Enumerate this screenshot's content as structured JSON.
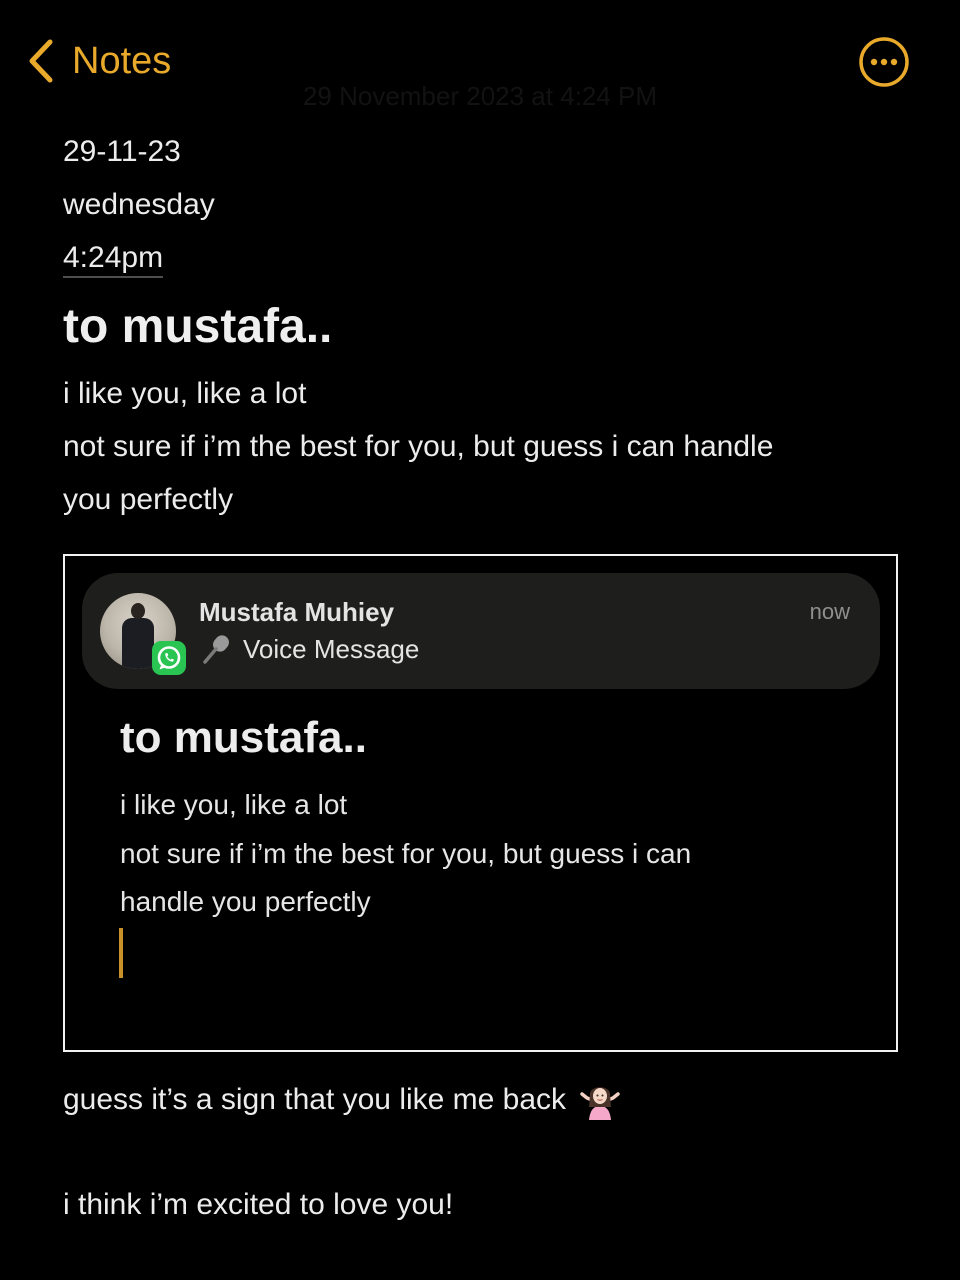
{
  "header": {
    "back_label": "Notes",
    "edited_text": "29 November 2023 at 4:24 PM"
  },
  "note": {
    "date": "29-11-23",
    "day": "wednesday",
    "time": "4:24pm",
    "title": "to mustafa..",
    "lines": [
      "i like you, like a lot",
      "not sure if i’m the best for you, but guess i can handle",
      "you perfectly"
    ]
  },
  "embedded_screenshot": {
    "notification": {
      "sender": "Mustafa Muhiey",
      "message": "Voice Message",
      "time": "now",
      "app_icon": "whatsapp-icon",
      "app_color": "#29c452"
    },
    "title": "to mustafa..",
    "lines": [
      "i like you, like a lot",
      "not sure if i’m the best for you, but guess i can",
      "handle you perfectly"
    ]
  },
  "after": {
    "line1": "guess it’s a sign that you like me back",
    "line1_emoji": "person-shrugging",
    "line2": "i think i’m excited to love you!"
  },
  "colors": {
    "accent": "#e9aa2c",
    "background": "#000000",
    "text": "#ececec"
  }
}
